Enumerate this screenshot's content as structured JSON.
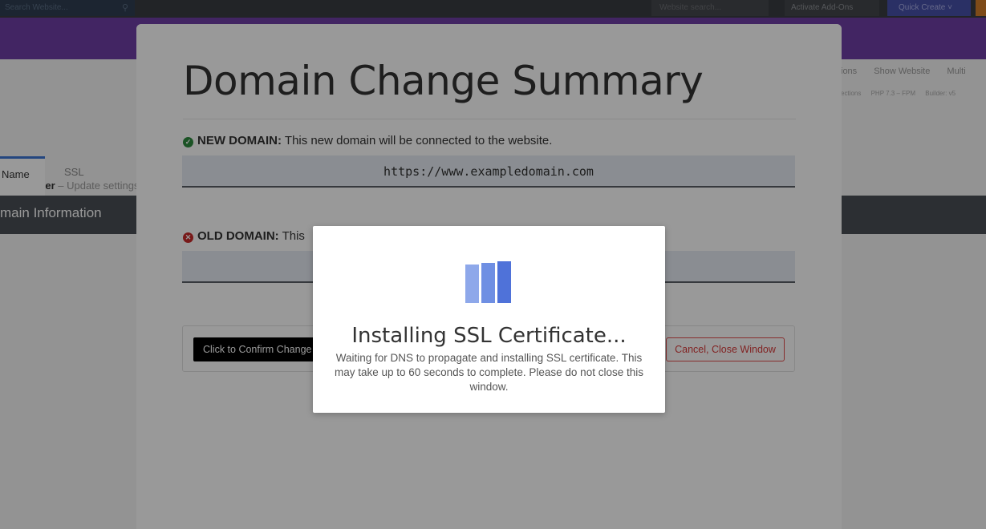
{
  "topbar": {
    "search_placeholder": "Search Website...",
    "website_search_placeholder": "Website search...",
    "activate_addons": "Activate Add-Ons",
    "quick_create": "Quick Create"
  },
  "subheader": {
    "breadcrumb_title": "in Manager",
    "breadcrumb_sub": "– Update settings",
    "right_links": [
      "ions",
      "Show Website",
      "Multi"
    ],
    "right_meta": [
      "ections",
      "PHP 7.3 – FPM",
      "Builder: v5"
    ]
  },
  "tabs": [
    {
      "label": "Name"
    },
    {
      "label": "SSL Security"
    }
  ],
  "section_title": "main Information",
  "modal": {
    "title": "Domain Change Summary",
    "new_domain": {
      "label": "NEW DOMAIN:",
      "description": "This new domain will be connected to the website.",
      "value": "https://www.exampledomain.com"
    },
    "old_domain": {
      "label": "OLD DOMAIN:",
      "description": "This",
      "value": ""
    },
    "confirm_button": "Click to Confirm Change",
    "cancel_button": "Cancel, Close Window"
  },
  "loader": {
    "title": "Installing SSL Certificate...",
    "message": "Waiting for DNS to propagate and installing SSL certificate. This may take up to 60 seconds to complete. Please do not close this window."
  },
  "colors": {
    "accent_blue": "#3c75d4",
    "purple_bar": "#6e3ea6",
    "ok_green": "#2e8b3e",
    "error_red": "#c92a2a",
    "loader_bar": "#4f72d9"
  }
}
